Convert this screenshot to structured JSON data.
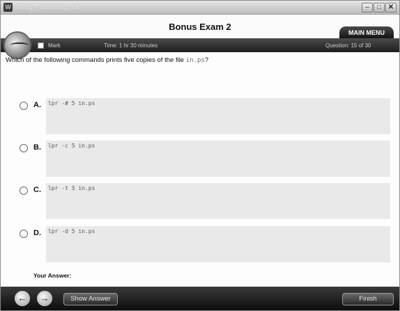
{
  "window": {
    "title": "Wiley Publishing, Inc."
  },
  "header": {
    "exam_title": "Bonus Exam 2",
    "main_menu_label": "MAIN MENU"
  },
  "infobar": {
    "mark_label": "Mark",
    "time_label": "Time: 1 hr 30 minutes",
    "question_label": "Question: 15 of 30"
  },
  "question": {
    "text": "Which of the following commands prints five copies of the file",
    "file": "in.ps",
    "suffix": "?"
  },
  "options": [
    {
      "letter": "A.",
      "code": "lpr -# 5 in.ps"
    },
    {
      "letter": "B.",
      "code": "lpr -c 5 in.ps"
    },
    {
      "letter": "C.",
      "code": "lpr -t 5 in.ps"
    },
    {
      "letter": "D.",
      "code": "lpr -d 5 in.ps"
    }
  ],
  "answer": {
    "label": "Your Answer:"
  },
  "footer": {
    "show_answer_label": "Show Answer",
    "finish_label": "Finish"
  }
}
